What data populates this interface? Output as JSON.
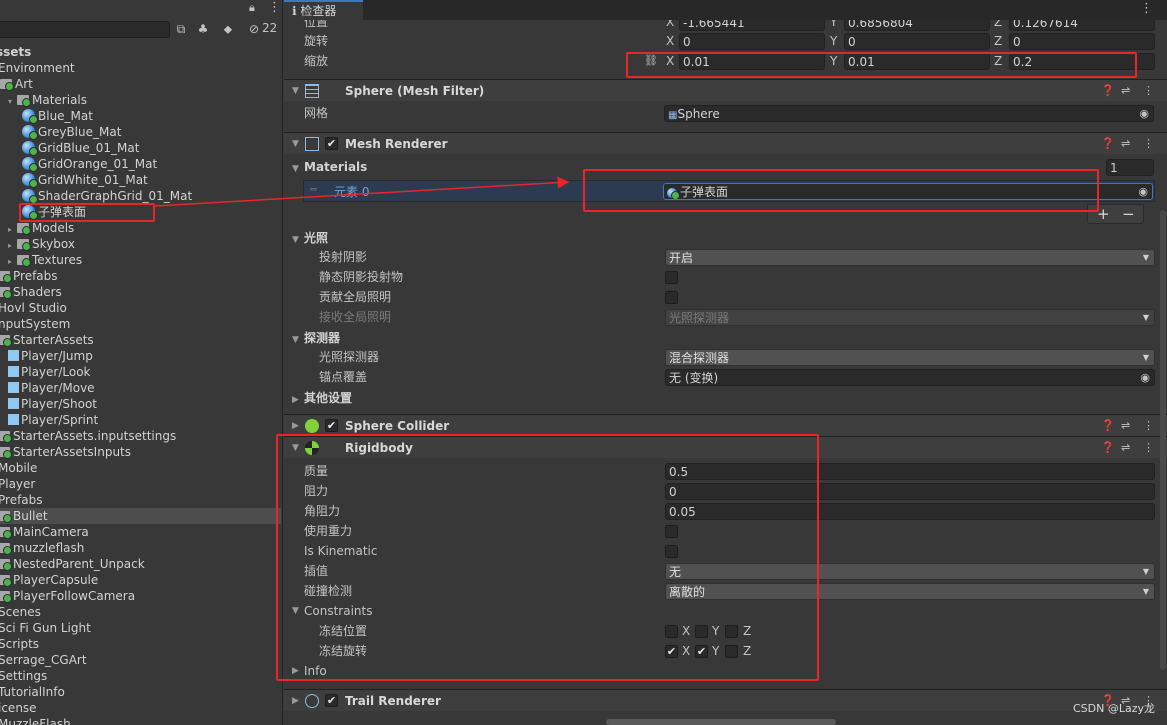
{
  "project": {
    "hidden_count": "22",
    "tree": [
      {
        "label": "ssets",
        "kind": "text",
        "indent": -4,
        "bold": true
      },
      {
        "label": "Environment",
        "kind": "text",
        "indent": -2
      },
      {
        "label": "Art",
        "kind": "folder",
        "indent": 0
      },
      {
        "label": "Materials",
        "kind": "folder",
        "indent": 8,
        "arrow": "▾"
      },
      {
        "label": "Blue_Mat",
        "kind": "mat",
        "indent": 22
      },
      {
        "label": "GreyBlue_Mat",
        "kind": "mat",
        "indent": 22
      },
      {
        "label": "GridBlue_01_Mat",
        "kind": "mat",
        "indent": 22
      },
      {
        "label": "GridOrange_01_Mat",
        "kind": "mat",
        "indent": 22
      },
      {
        "label": "GridWhite_01_Mat",
        "kind": "mat",
        "indent": 22
      },
      {
        "label": "ShaderGraphGrid_01_Mat",
        "kind": "mat",
        "indent": 22
      },
      {
        "label": "子弹表面",
        "kind": "mat",
        "indent": 22
      },
      {
        "label": "Models",
        "kind": "folder",
        "indent": 8,
        "arrow": "▸"
      },
      {
        "label": "Skybox",
        "kind": "folder",
        "indent": 8,
        "arrow": "▸"
      },
      {
        "label": "Textures",
        "kind": "folder",
        "indent": 8,
        "arrow": "▸"
      },
      {
        "label": "Prefabs",
        "kind": "folder",
        "indent": -2
      },
      {
        "label": "Shaders",
        "kind": "folder",
        "indent": -2
      },
      {
        "label": "Hovl Studio",
        "kind": "text",
        "indent": -2
      },
      {
        "label": "nputSystem",
        "kind": "text",
        "indent": -2
      },
      {
        "label": "StarterAssets",
        "kind": "folder",
        "indent": -2
      },
      {
        "label": "Player/Jump",
        "kind": "prefab",
        "indent": 8
      },
      {
        "label": "Player/Look",
        "kind": "prefab",
        "indent": 8
      },
      {
        "label": "Player/Move",
        "kind": "prefab",
        "indent": 8
      },
      {
        "label": "Player/Shoot",
        "kind": "prefab",
        "indent": 8
      },
      {
        "label": "Player/Sprint",
        "kind": "prefab",
        "indent": 8
      },
      {
        "label": "StarterAssets.inputsettings",
        "kind": "folder",
        "indent": -2
      },
      {
        "label": "StarterAssetsInputs",
        "kind": "folder",
        "indent": -2
      },
      {
        "label": "Mobile",
        "kind": "text",
        "indent": -2
      },
      {
        "label": "Player",
        "kind": "text",
        "indent": -2
      },
      {
        "label": "Prefabs",
        "kind": "text",
        "indent": -2
      },
      {
        "label": "Bullet",
        "kind": "folder",
        "indent": -2,
        "selected": true
      },
      {
        "label": "MainCamera",
        "kind": "folder",
        "indent": -2
      },
      {
        "label": "muzzleflash",
        "kind": "folder",
        "indent": -2
      },
      {
        "label": "NestedParent_Unpack",
        "kind": "folder",
        "indent": -2
      },
      {
        "label": "PlayerCapsule",
        "kind": "folder",
        "indent": -2
      },
      {
        "label": "PlayerFollowCamera",
        "kind": "folder",
        "indent": -2
      },
      {
        "label": "Scenes",
        "kind": "text",
        "indent": -2
      },
      {
        "label": "Sci Fi Gun Light",
        "kind": "text",
        "indent": -2
      },
      {
        "label": "Scripts",
        "kind": "text",
        "indent": -2
      },
      {
        "label": "Serrage_CGArt",
        "kind": "text",
        "indent": -2
      },
      {
        "label": "Settings",
        "kind": "text",
        "indent": -2
      },
      {
        "label": "TutorialInfo",
        "kind": "text",
        "indent": -2
      },
      {
        "label": "icense",
        "kind": "text",
        "indent": -2
      },
      {
        "label": "MuzzleFlash",
        "kind": "text",
        "indent": -2
      }
    ]
  },
  "inspector": {
    "tab_label": "检查器",
    "transform": {
      "position_label": "位置",
      "rotation_label": "旋转",
      "scale_label": "缩放",
      "position": {
        "x": "-1.665441",
        "y": "0.6856804",
        "z": "0.1267614"
      },
      "rotation": {
        "x": "0",
        "y": "0",
        "z": "0"
      },
      "scale": {
        "x": "0.01",
        "y": "0.01",
        "z": "0.2"
      },
      "axis_x": "X",
      "axis_y": "Y",
      "axis_z": "Z"
    },
    "mesh_filter": {
      "title": "Sphere (Mesh Filter)",
      "mesh_label": "网格",
      "mesh_value": "Sphere"
    },
    "mesh_renderer": {
      "title": "Mesh Renderer",
      "materials_label": "Materials",
      "materials_count": "1",
      "element_label": "元素 0",
      "element_value": "子弹表面",
      "add": "+",
      "remove": "−",
      "lighting_label": "光照",
      "cast_shadows_label": "投射阴影",
      "cast_shadows_value": "开启",
      "static_shadow_label": "静态阴影投射物",
      "contribute_gi_label": "贡献全局照明",
      "receive_gi_label": "接收全局照明",
      "receive_gi_value": "光照探测器",
      "probes_label": "探测器",
      "light_probes_label": "光照探测器",
      "light_probes_value": "混合探测器",
      "anchor_override_label": "锚点覆盖",
      "anchor_override_value": "无 (变换)",
      "additional_label": "其他设置"
    },
    "sphere_collider": {
      "title": "Sphere Collider"
    },
    "rigidbody": {
      "title": "Rigidbody",
      "mass_label": "质量",
      "mass": "0.5",
      "drag_label": "阻力",
      "drag": "0",
      "angular_drag_label": "角阻力",
      "angular_drag": "0.05",
      "use_gravity_label": "使用重力",
      "is_kinematic_label": "Is Kinematic",
      "interpolate_label": "插值",
      "interpolate_value": "无",
      "collision_label": "碰撞检测",
      "collision_value": "离散的",
      "constraints_label": "Constraints",
      "freeze_pos_label": "冻结位置",
      "freeze_rot_label": "冻结旋转",
      "freeze_pos": {
        "x": false,
        "y": false,
        "z": false
      },
      "freeze_rot": {
        "x": true,
        "y": true,
        "z": false
      },
      "info_label": "Info"
    },
    "trail_renderer": {
      "title": "Trail Renderer"
    }
  },
  "watermark": "CSDN @Lazy龙",
  "colors": {
    "annotation": "#e8262a",
    "selection": "#3a79bb",
    "panel": "#383838"
  }
}
